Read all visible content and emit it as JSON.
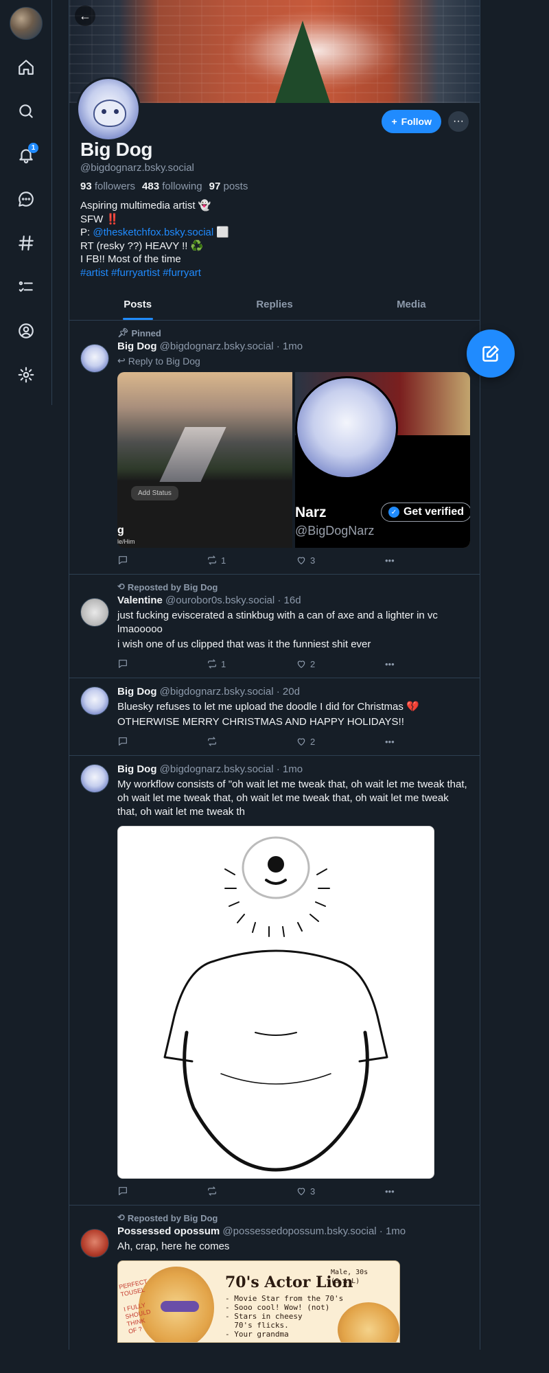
{
  "colors": {
    "accent": "#208bfe",
    "background": "#161e27",
    "muted": "#8d9aab",
    "like_heart": "#ffffff"
  },
  "sidebar": {
    "items": [
      {
        "name": "home",
        "icon": "home-icon"
      },
      {
        "name": "search",
        "icon": "search-icon"
      },
      {
        "name": "notifications",
        "icon": "bell-icon",
        "badge": "1"
      },
      {
        "name": "chat",
        "icon": "chat-icon"
      },
      {
        "name": "feeds",
        "icon": "hashtag-icon"
      },
      {
        "name": "lists",
        "icon": "list-icon"
      },
      {
        "name": "profile",
        "icon": "user-icon"
      },
      {
        "name": "settings",
        "icon": "gear-icon"
      }
    ]
  },
  "profile": {
    "display_name": "Big Dog",
    "handle": "@bigdognarz.bsky.social",
    "followers_count": "93",
    "followers_label": "followers",
    "following_count": "483",
    "following_label": "following",
    "posts_count": "97",
    "posts_label": "posts",
    "follow_label": "Follow",
    "bio": {
      "line1": "Aspiring multimedia artist 👻",
      "line2": "SFW ‼️",
      "line3_prefix": "P: ",
      "line3_link": "@thesketchfox.bsky.social",
      "line3_suffix": " ⬜",
      "line4": "RT (resky ??) HEAVY !! ♻️",
      "line5": "I FB!! Most of the time",
      "tags": [
        "#artist",
        "#furryartist",
        "#furryart"
      ]
    }
  },
  "tabs": [
    "Posts",
    "Replies",
    "Media"
  ],
  "posts": [
    {
      "context": "Pinned",
      "name": "Big Dog",
      "handle": "@bigdognarz.bsky.social",
      "time": "· 1mo",
      "reply_to": "Reply to Big Dog",
      "image_a": {
        "button": "Add Status",
        "name_fragment": "g",
        "pronouns": "le/Him"
      },
      "image_b": {
        "name_fragment": "Narz",
        "handle_fragment": "@BigDogNarz",
        "verify_label": "Get verified"
      },
      "replies": "",
      "reposts": "1",
      "likes": "3"
    },
    {
      "context": "Reposted by Big Dog",
      "name": "Valentine",
      "handle": "@ourobor0s.bsky.social",
      "time": "· 16d",
      "text1": "just fucking eviscerated a stinkbug with a can of axe and a lighter in vc lmaooooo",
      "text2": "i wish one of us clipped that was it the funniest shit ever",
      "replies": "",
      "reposts": "1",
      "likes": "2"
    },
    {
      "name": "Big Dog",
      "handle": "@bigdognarz.bsky.social",
      "time": "· 20d",
      "text1": "Bluesky refuses to let me upload the doodle I did for Christmas 💔",
      "text2": "OTHERWISE MERRY CHRISTMAS AND HAPPY HOLIDAYS!!",
      "replies": "",
      "reposts": "",
      "likes": "2"
    },
    {
      "name": "Big Dog",
      "handle": "@bigdognarz.bsky.social",
      "time": "· 1mo",
      "text1": "My workflow consists of \"oh wait let me tweak that, oh wait let me tweak that, oh wait let me tweak that, oh wait let me tweak that, oh wait let me tweak that, oh wait let me tweak th",
      "replies": "",
      "reposts": "",
      "likes": "3"
    },
    {
      "context": "Reposted by Big Dog",
      "name": "Possessed opossum",
      "handle": "@possessedopossum.bsky.social",
      "time": "· 1mo",
      "text1": "Ah, crap, here he comes",
      "image": {
        "title": "70's Actor Lion",
        "subtitle": "Male, 30s\n(S.A.L)",
        "list": "- Movie Star from the 70's\n- Sooo cool! Wow! (not)\n- Stars in cheesy\n  70's flicks.\n- Your grandma",
        "note": "PERFECT\nTOUSEL\n\nI FULLY\nSHOULD\nTHINK\nOF ?"
      }
    }
  ]
}
